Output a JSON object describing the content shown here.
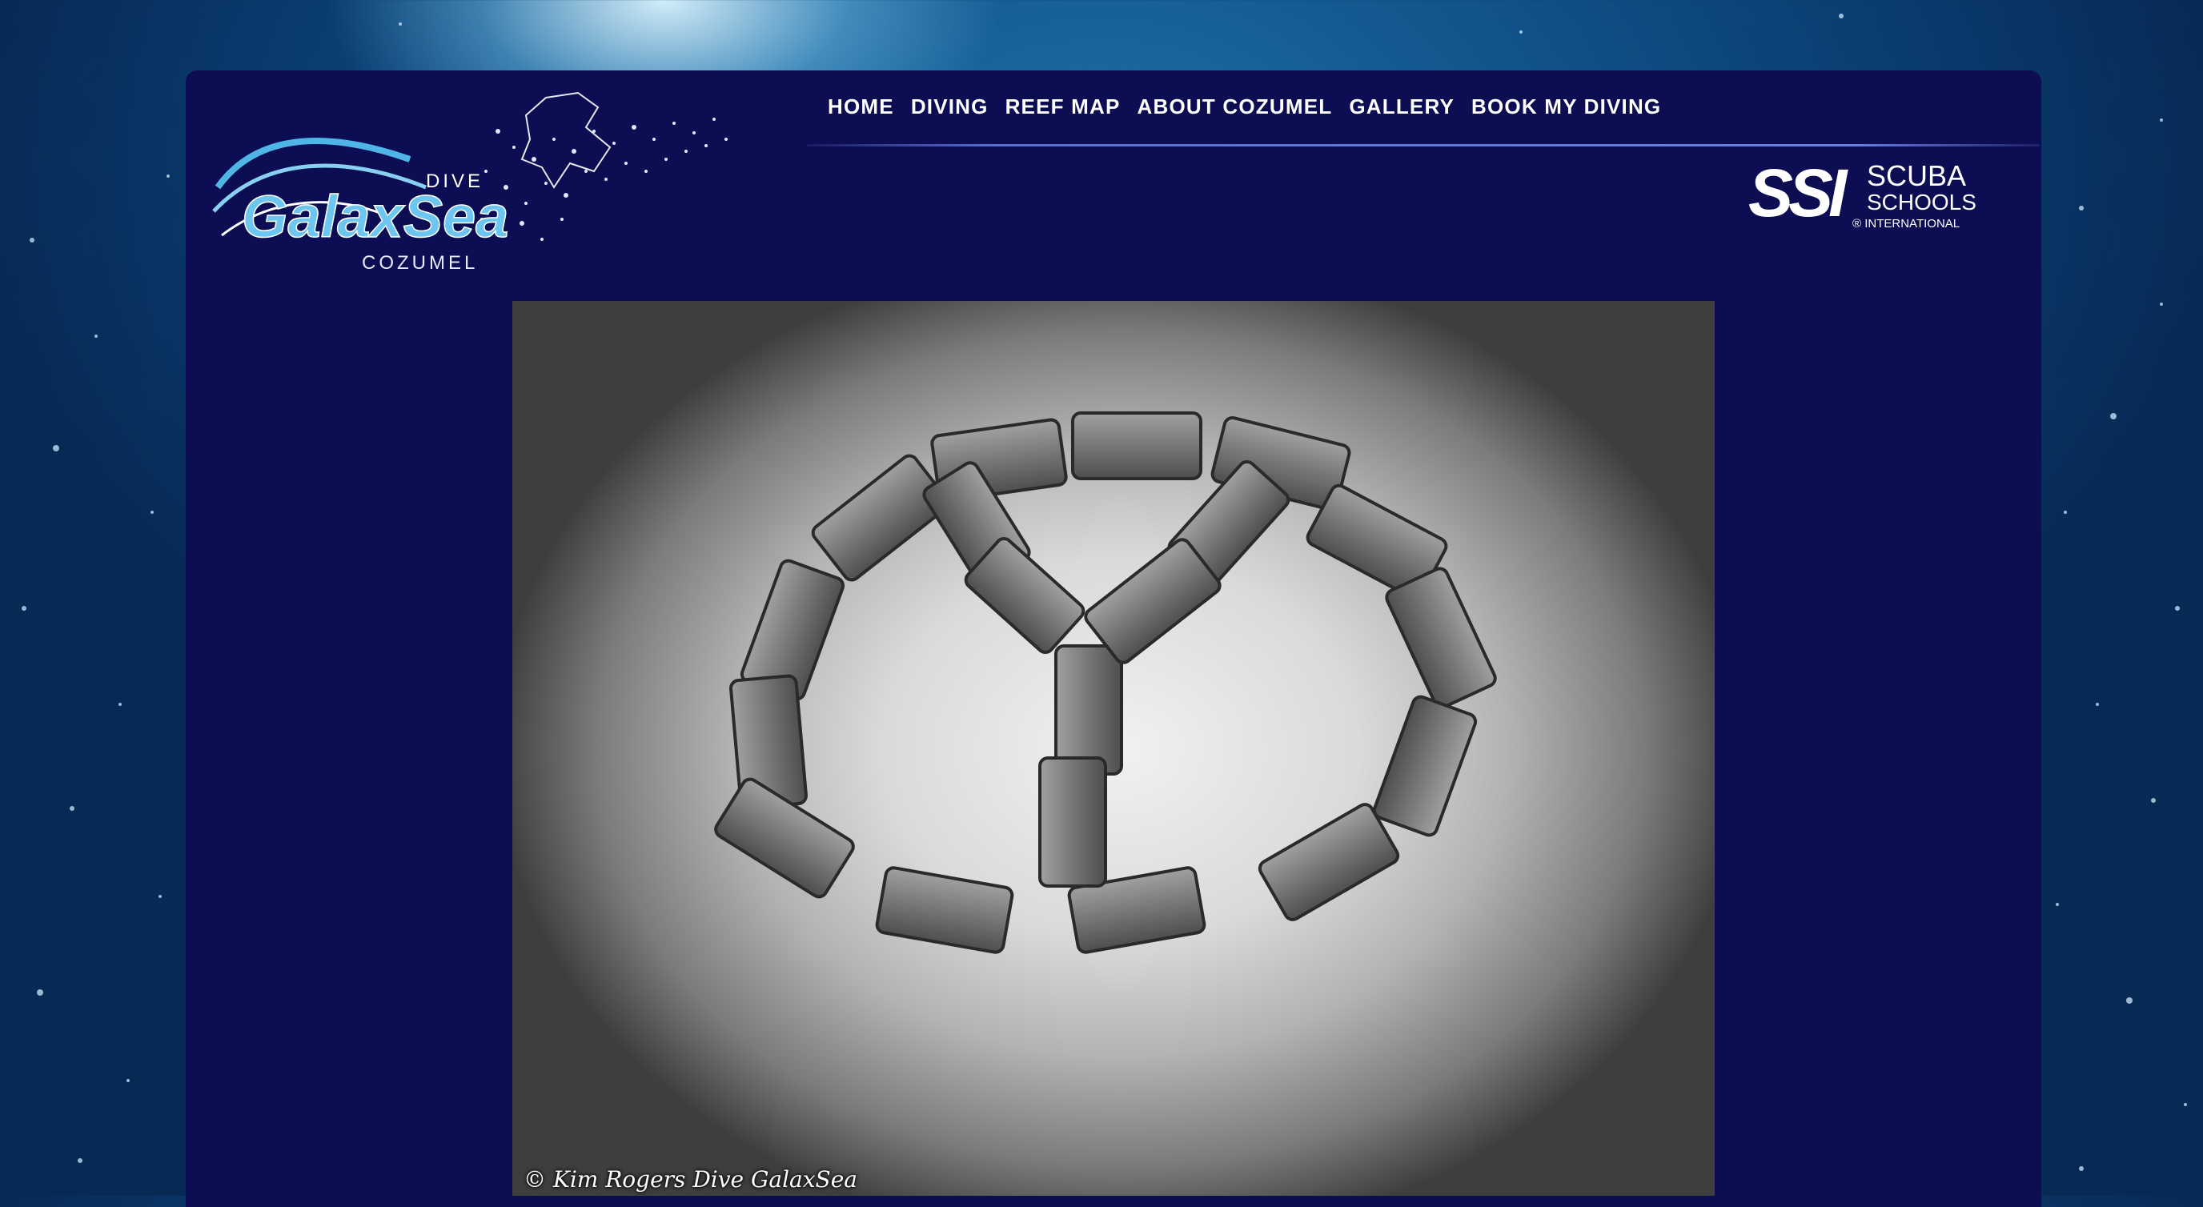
{
  "brand": {
    "dive": "DIVE",
    "name_part1": "Galax",
    "name_part2": "Sea",
    "location": "COZUMEL"
  },
  "nav": {
    "items": [
      "HOME",
      "DIVING",
      "REEF MAP",
      "ABOUT COZUMEL",
      "GALLERY",
      "BOOK MY DIVING"
    ]
  },
  "partner": {
    "mark": "SSI",
    "line1": "SCUBA",
    "line2": "SCHOOLS",
    "line3": "® INTERNATIONAL"
  },
  "photo": {
    "credit": "© Kim Rogers Dive GalaxSea"
  },
  "colors": {
    "panel": "#0c0d52",
    "accent": "#4fb4e6",
    "text": "#ffffff"
  }
}
